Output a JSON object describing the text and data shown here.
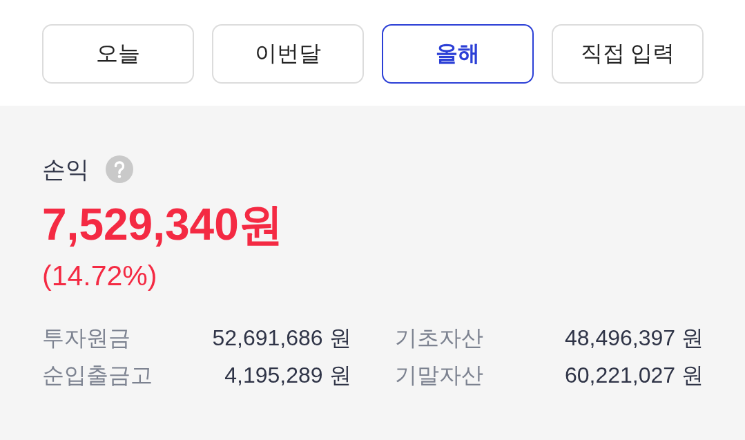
{
  "period_tabs": [
    {
      "label": "오늘",
      "selected": false
    },
    {
      "label": "이번달",
      "selected": false
    },
    {
      "label": "올해",
      "selected": true
    },
    {
      "label": "직접 입력",
      "selected": false
    }
  ],
  "profit": {
    "label": "손익",
    "amount": "7,529,340원",
    "rate": "(14.72%)"
  },
  "details": [
    {
      "label": "투자원금",
      "value": "52,691,686 원"
    },
    {
      "label": "기초자산",
      "value": "48,496,397 원"
    },
    {
      "label": "순입출금고",
      "value": "4,195,289 원"
    },
    {
      "label": "기말자산",
      "value": "60,221,027 원"
    }
  ]
}
